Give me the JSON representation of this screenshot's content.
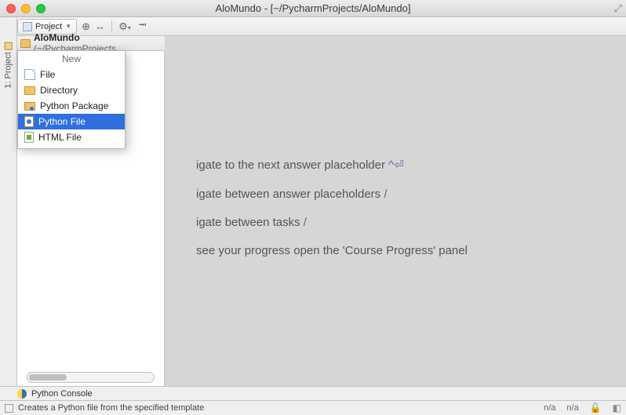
{
  "window": {
    "title": "AloMundo - [~/PycharmProjects/AloMundo]"
  },
  "toolbar": {
    "project_button": "Project"
  },
  "sidebar_tab": {
    "label": "1: Project"
  },
  "project_tree": {
    "root_name": "AloMundo",
    "root_path": "(~/PycharmProjects"
  },
  "context_menu": {
    "title": "New",
    "items": [
      {
        "label": "File",
        "icon": "file-icon",
        "selected": false
      },
      {
        "label": "Directory",
        "icon": "directory-icon",
        "selected": false
      },
      {
        "label": "Python Package",
        "icon": "python-package-icon",
        "selected": false
      },
      {
        "label": "Python File",
        "icon": "python-file-icon",
        "selected": true
      },
      {
        "label": "HTML File",
        "icon": "html-file-icon",
        "selected": false
      }
    ]
  },
  "editor_hints": {
    "line1_pre": "igate to the next answer placeholder ",
    "line1_shortcut": "^⏎",
    "line2_pre": "igate between answer placeholders  ",
    "line2_shortcut": "/",
    "line3_pre": "igate between tasks  ",
    "line3_shortcut": "/",
    "line4": "see your progress open the 'Course Progress' panel"
  },
  "bottom_panel": {
    "label": "Python Console"
  },
  "status_bar": {
    "message": "Creates a Python file from the specified template",
    "right1": "n/a",
    "right2": "n/a"
  }
}
